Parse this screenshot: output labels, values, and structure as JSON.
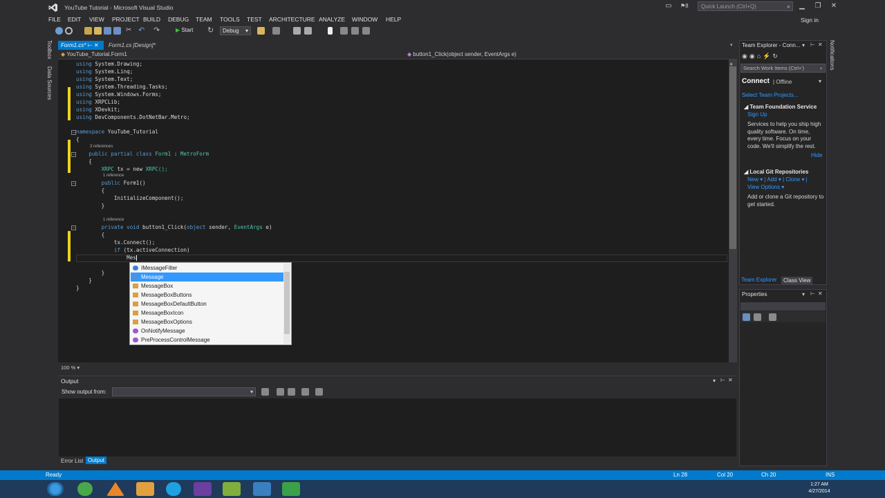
{
  "window": {
    "title": "YouTube Tutorial - Microsoft Visual Studio"
  },
  "quick_launch": {
    "placeholder": "Quick Launch (Ctrl+Q)"
  },
  "notifications": {
    "count": "8"
  },
  "menu": [
    "FILE",
    "EDIT",
    "VIEW",
    "PROJECT",
    "BUILD",
    "DEBUG",
    "TEAM",
    "TOOLS",
    "TEST",
    "ARCHITECTURE",
    "ANALYZE",
    "WINDOW",
    "HELP"
  ],
  "signin": "Sign in",
  "toolbar": {
    "start_label": "Start",
    "configuration": "Debug"
  },
  "left_strip": {
    "toolbox": "Toolbox",
    "data_sources": "Data Sources"
  },
  "tabs": [
    {
      "label": "Form1.cs*"
    },
    {
      "label": "Form1.cs [Design]*"
    }
  ],
  "nav": {
    "left": "YouTube_Tutorial.Form1",
    "right": "button1_Click(object sender, EventArgs e)"
  },
  "code": {
    "l1": "using System.Drawing;",
    "l2": "using System.Linq;",
    "l3": "using System.Text;",
    "l4": "using System.Threading.Tasks;",
    "l5": "using System.Windows.Forms;",
    "l6": "using XRPCLib;",
    "l7": "using XDevkit;",
    "l8": "using DevComponents.DotNetBar.Metro;",
    "ns": "YouTube_Tutorial",
    "class_refs": "3 references",
    "class_name": "Form1",
    "class_base": "MetroForm",
    "field_type": "XRPC",
    "field_rest": " tx = new ",
    "field_ctor": "XRPC();",
    "ctor_refs": "1 reference",
    "ctor": "Form1()",
    "init": "InitializeComponent();",
    "click_refs": "1 reference",
    "click_name": "button1_Click(",
    "click_args": " sender, ",
    "click_argtype": "EventArgs",
    "click_end": " e)",
    "connect": "tx.Connect();",
    "if_cond": " (tx.activeConnection)",
    "typed": "Mes"
  },
  "completion": [
    {
      "label": "IMessageFilter",
      "kind": "interface"
    },
    {
      "label": "Message",
      "kind": "struct",
      "selected": true
    },
    {
      "label": "MessageBox",
      "kind": "class"
    },
    {
      "label": "MessageBoxButtons",
      "kind": "enum"
    },
    {
      "label": "MessageBoxDefaultButton",
      "kind": "enum"
    },
    {
      "label": "MessageBoxIcon",
      "kind": "enum"
    },
    {
      "label": "MessageBoxOptions",
      "kind": "enum"
    },
    {
      "label": "OnNotifyMessage",
      "kind": "method"
    },
    {
      "label": "PreProcessControlMessage",
      "kind": "method"
    }
  ],
  "zoom": "100 %",
  "output": {
    "title": "Output",
    "show_from": "Show output from:"
  },
  "bottom_tabs": {
    "errors": "Error List",
    "output": "Output"
  },
  "team_explorer": {
    "title": "Team Explorer - Conn...",
    "search_placeholder": "Search Work Items (Ctrl+')",
    "connect": "Connect",
    "offline": "| Offline",
    "select_projects": "Select Team Projects...",
    "tfs_head": "Team Foundation Service",
    "signup": "Sign Up",
    "tfs_text": "Services to help you ship high quality software. On time, every time. Focus on your code. We'll simplify the rest.",
    "hide": "Hide",
    "git_head": "Local Git Repositories",
    "git_links_1": "New ▾ | Add ▾ | Clone ▾ |",
    "git_links_2": "View Options ▾",
    "git_text": "Add or clone a Git repository to get started.",
    "tab_te": "Team Explorer",
    "tab_cv": "Class View"
  },
  "properties": {
    "title": "Properties"
  },
  "right_strip": {
    "notifications": "Notifications"
  },
  "status": {
    "ready": "Ready",
    "ln": "Ln 28",
    "col": "Col 20",
    "ch": "Ch 20",
    "ins": "INS"
  },
  "clock": {
    "time": "1:27 AM",
    "date": "4/27/2014"
  },
  "colors": {
    "accent": "#007acc",
    "keyword": "#569cd6",
    "type": "#4ec9b0",
    "selection": "#3399ff",
    "change_marker": "#efd31a"
  }
}
